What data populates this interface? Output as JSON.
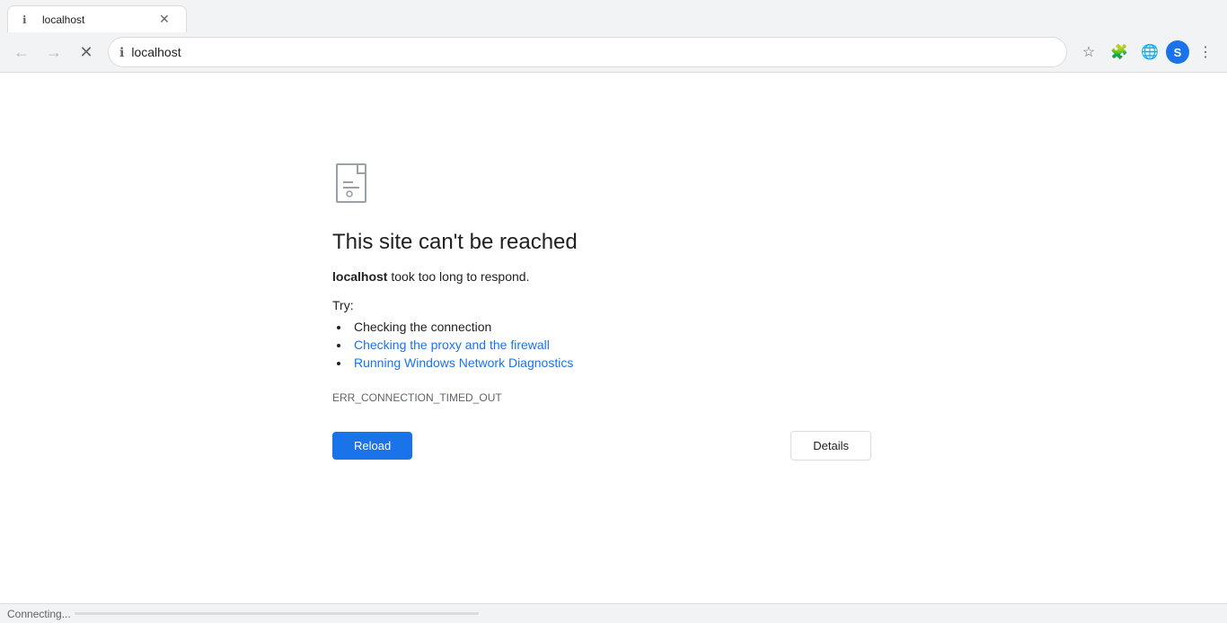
{
  "browser": {
    "tab": {
      "title": "localhost",
      "favicon": "ℹ"
    },
    "address": "localhost",
    "address_icon": "ℹ"
  },
  "toolbar": {
    "back_label": "←",
    "forward_label": "→",
    "close_label": "✕",
    "bookmark_icon": "☆",
    "extensions_icon": "🧩",
    "globe_icon": "🌐",
    "profile_label": "S",
    "menu_icon": "⋮"
  },
  "error": {
    "title": "This site can't be reached",
    "subtitle_host": "localhost",
    "subtitle_rest": " took too long to respond.",
    "try_label": "Try:",
    "suggestions": [
      {
        "text": "Checking the connection",
        "link": false
      },
      {
        "text": "Checking the proxy and the firewall",
        "link": true
      },
      {
        "text": "Running Windows Network Diagnostics",
        "link": true
      }
    ],
    "error_code": "ERR_CONNECTION_TIMED_OUT",
    "reload_label": "Reload",
    "details_label": "Details"
  },
  "status": {
    "text": "Connecting..."
  }
}
